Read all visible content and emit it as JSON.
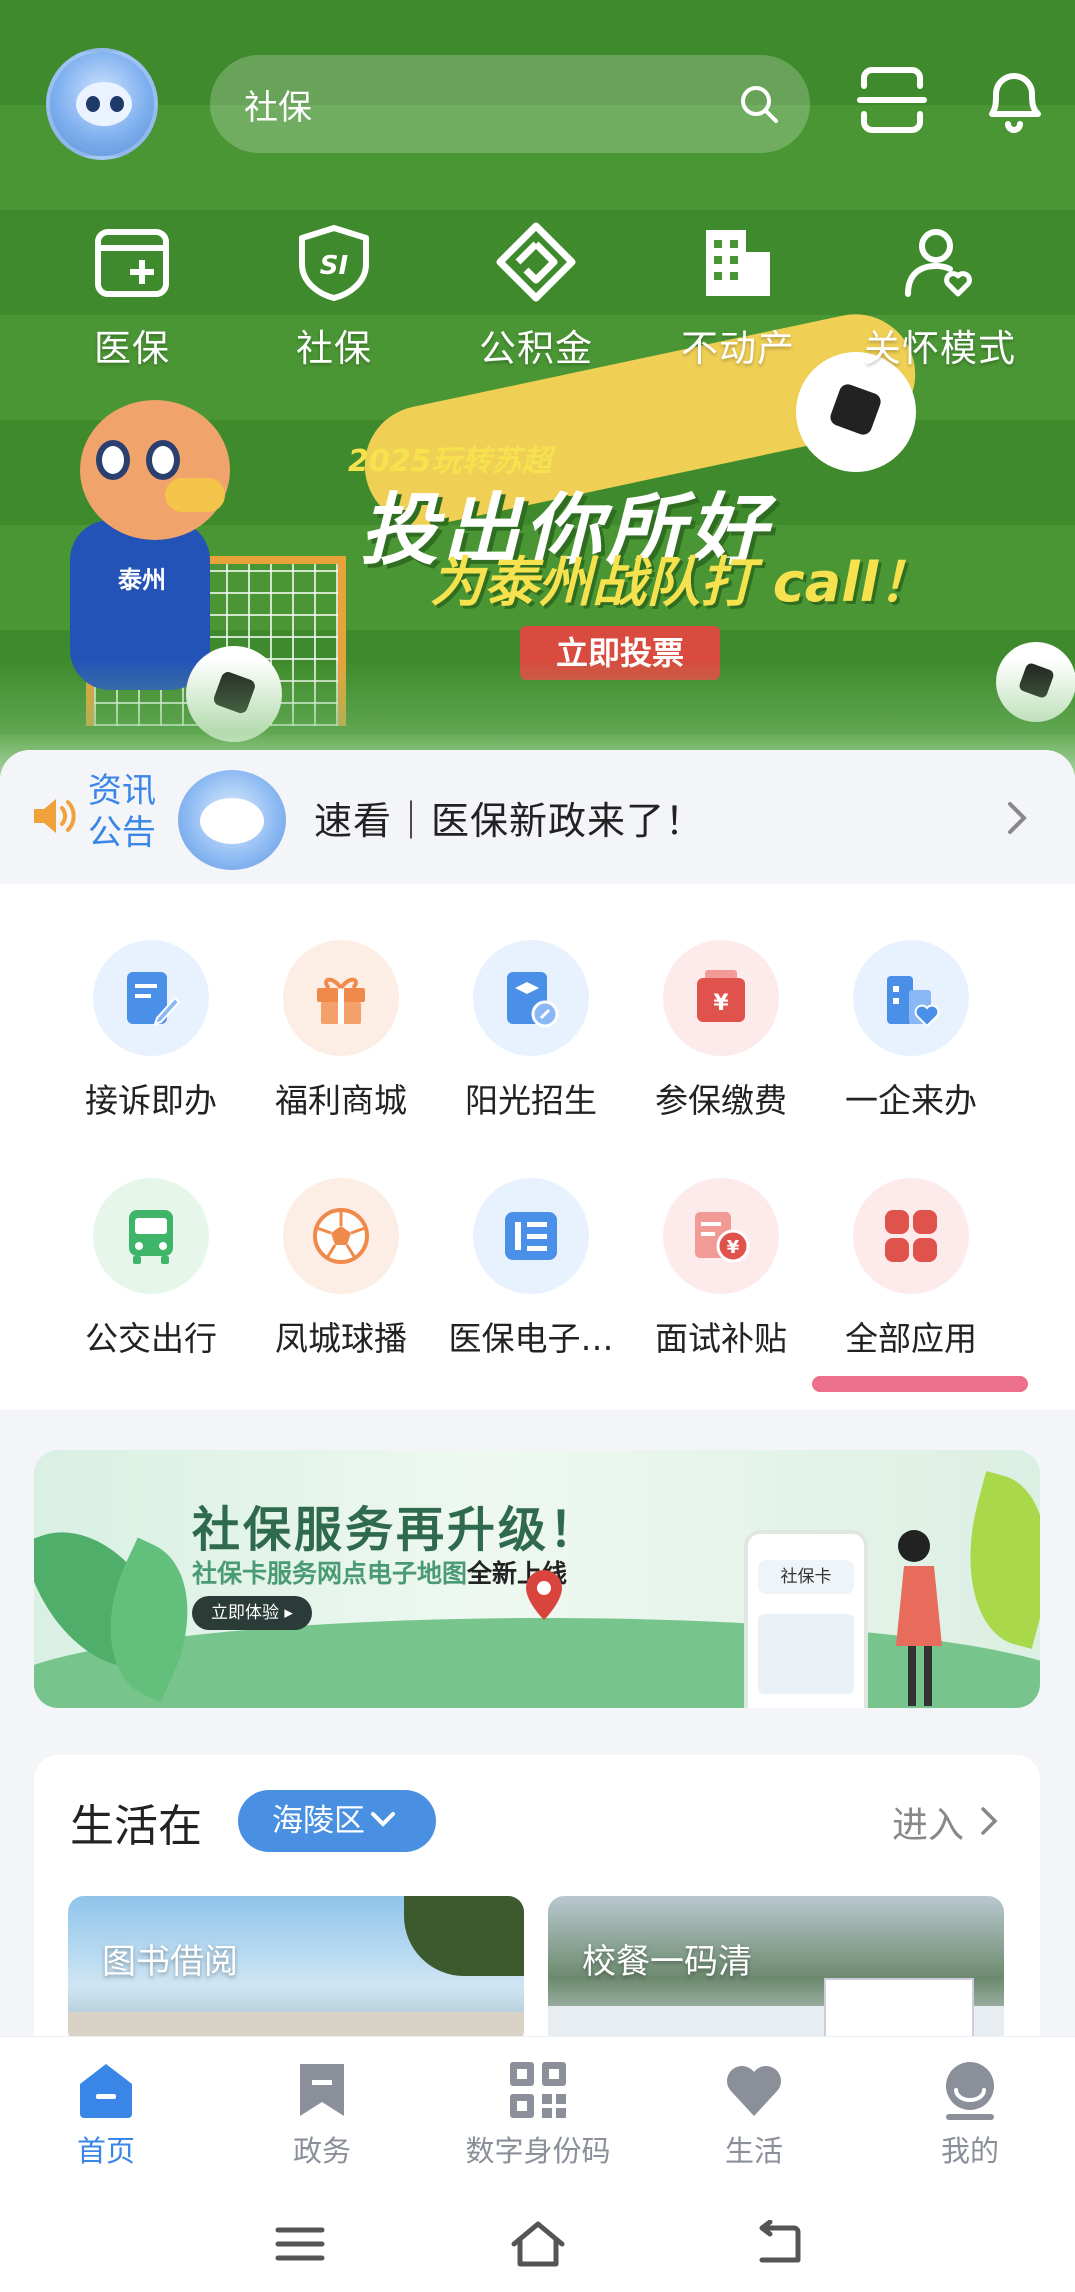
{
  "header": {
    "search_text": "社保"
  },
  "quick_nav": [
    {
      "label": "医保",
      "icon": "medical-card-icon"
    },
    {
      "label": "社保",
      "icon": "social-security-icon"
    },
    {
      "label": "公积金",
      "icon": "housing-fund-icon"
    },
    {
      "label": "不动产",
      "icon": "building-icon"
    },
    {
      "label": "关怀模式",
      "icon": "care-mode-icon"
    }
  ],
  "banner": {
    "small": "2025玩转苏超",
    "title": "投出你所好",
    "subtitle": "为泰州战队打 call！",
    "button": "立即投票",
    "mascot_text": "泰州"
  },
  "notice": {
    "tag_line1": "资讯",
    "tag_line2": "公告",
    "text": "速看｜医保新政来了！"
  },
  "apps": [
    {
      "label": "接诉即办",
      "icon": "complaint-icon",
      "bg": "#e8f2ff"
    },
    {
      "label": "福利商城",
      "icon": "gift-icon",
      "bg": "#fdeee5"
    },
    {
      "label": "阳光招生",
      "icon": "enrollment-icon",
      "bg": "#e8f2ff"
    },
    {
      "label": "参保缴费",
      "icon": "payment-icon",
      "bg": "#fdeaea"
    },
    {
      "label": "一企来办",
      "icon": "enterprise-icon",
      "bg": "#e8f2ff"
    },
    {
      "label": "公交出行",
      "icon": "bus-icon",
      "bg": "#e6f6ea"
    },
    {
      "label": "凤城球播",
      "icon": "soccer-ball-icon",
      "bg": "#fdeee5"
    },
    {
      "label": "医保电子…",
      "icon": "e-card-icon",
      "bg": "#e8f2ff"
    },
    {
      "label": "面试补贴",
      "icon": "subsidy-icon",
      "bg": "#fdeaea"
    },
    {
      "label": "全部应用",
      "icon": "all-apps-icon",
      "bg": "#fdeaea"
    }
  ],
  "promo": {
    "title": "社保服务再升级！",
    "sub_prefix": "社保卡服务网点电子地图",
    "sub_suffix": "全新上线",
    "button": "立即体验 ▸",
    "phone_label": "社保卡"
  },
  "life": {
    "title": "生活在",
    "district": "海陵区",
    "enter": "进入",
    "cards": [
      {
        "label": "图书借阅"
      },
      {
        "label": "校餐一码清"
      }
    ]
  },
  "tabbar": [
    {
      "label": "首页",
      "icon": "home-icon",
      "active": true
    },
    {
      "label": "政务",
      "icon": "government-icon",
      "active": false
    },
    {
      "label": "数字身份码",
      "icon": "qr-code-icon",
      "active": false
    },
    {
      "label": "生活",
      "icon": "heart-icon",
      "active": false
    },
    {
      "label": "我的",
      "icon": "profile-icon",
      "active": false
    }
  ],
  "colors": {
    "accent": "#3a86e6",
    "field_green": "#3f8a2c",
    "underline": "#ec6f8b"
  }
}
